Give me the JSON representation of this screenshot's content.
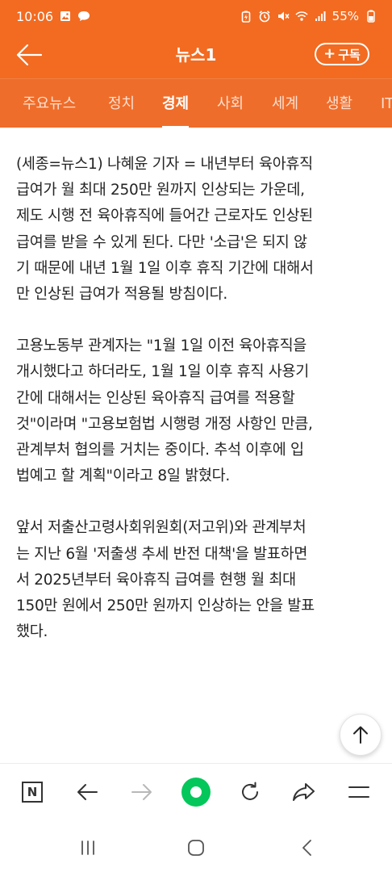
{
  "status_bar": {
    "time": "10:06",
    "battery": "55%",
    "left_icons": [
      "image-icon",
      "chat-bubble-icon"
    ],
    "right_icons": [
      "battery-saver-icon",
      "alarm-icon",
      "mute-icon",
      "wifi-icon",
      "signal-icon",
      "battery-icon"
    ]
  },
  "header": {
    "title": "뉴스1",
    "subscribe_label": "구독",
    "background_color": "#f26b21"
  },
  "tabs": [
    {
      "label": "주요뉴스",
      "active": false
    },
    {
      "label": "정치",
      "active": false
    },
    {
      "label": "경제",
      "active": true
    },
    {
      "label": "사회",
      "active": false
    },
    {
      "label": "세계",
      "active": false
    },
    {
      "label": "생활",
      "active": false
    },
    {
      "label": "IT",
      "active": false
    }
  ],
  "article": {
    "paragraphs": [
      [
        "(세종=뉴스1) 나혜윤 기자 = 내년부터 육아휴직",
        "급여가 월 최대 250만 원까지 인상되는 가운데,",
        "제도 시행 전 육아휴직에 들어간 근로자도 인상된",
        "급여를 받을 수 있게 된다. 다만 '소급'은 되지 않",
        "기 때문에 내년 1월 1일 이후 휴직 기간에 대해서",
        "만 인상된 급여가 적용될 방침이다."
      ],
      [
        "고용노동부 관계자는 \"1월 1일 이전 육아휴직을",
        "개시했다고 하더라도, 1월 1일 이후 휴직 사용기",
        "간에 대해서는 인상된 육아휴직 급여를 적용할",
        "것\"이라며 \"고용보험법 시행령 개정 사항인 만큼,",
        "관계부처 협의를 거치는 중이다. 추석 이후에 입",
        "법예고 할 계획\"이라고 8일 밝혔다."
      ],
      [
        "앞서 저출산고령사회위원회(저고위)와 관계부처",
        "는 지난 6월 '저출생 추세 반전 대책'을 발표하면",
        "서 2025년부터 육아휴직 급여를 현행 월 최대",
        "150만 원에서 250만 원까지 인상하는 안을 발표",
        "했다."
      ]
    ]
  },
  "scroll_top_icon": "arrow-up-icon",
  "browser_toolbar": {
    "items": [
      "naver-n-icon",
      "back-arrow-icon",
      "forward-arrow-icon",
      "green-home-icon",
      "refresh-icon",
      "share-icon",
      "menu-icon"
    ],
    "n_label": "N",
    "accent_color": "#03c75a"
  },
  "system_nav": {
    "items": [
      "recent-apps-icon",
      "home-icon",
      "back-icon"
    ]
  }
}
